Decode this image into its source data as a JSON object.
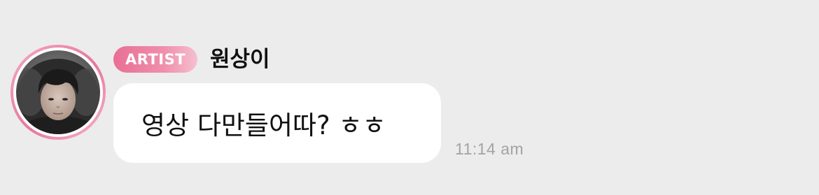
{
  "message": {
    "badge_label": "ARTIST",
    "sender_name": "원상이",
    "text": "영상 다만들어따? ㅎㅎ",
    "timestamp": "11:14 am"
  },
  "colors": {
    "background": "#ececec",
    "badge_gradient_start": "#e86f93",
    "badge_gradient_end": "#f6bfd0",
    "avatar_ring": "#e8779c",
    "bubble": "#ffffff",
    "timestamp": "#a3a3a3"
  },
  "icons": {
    "avatar": "profile-photo"
  }
}
